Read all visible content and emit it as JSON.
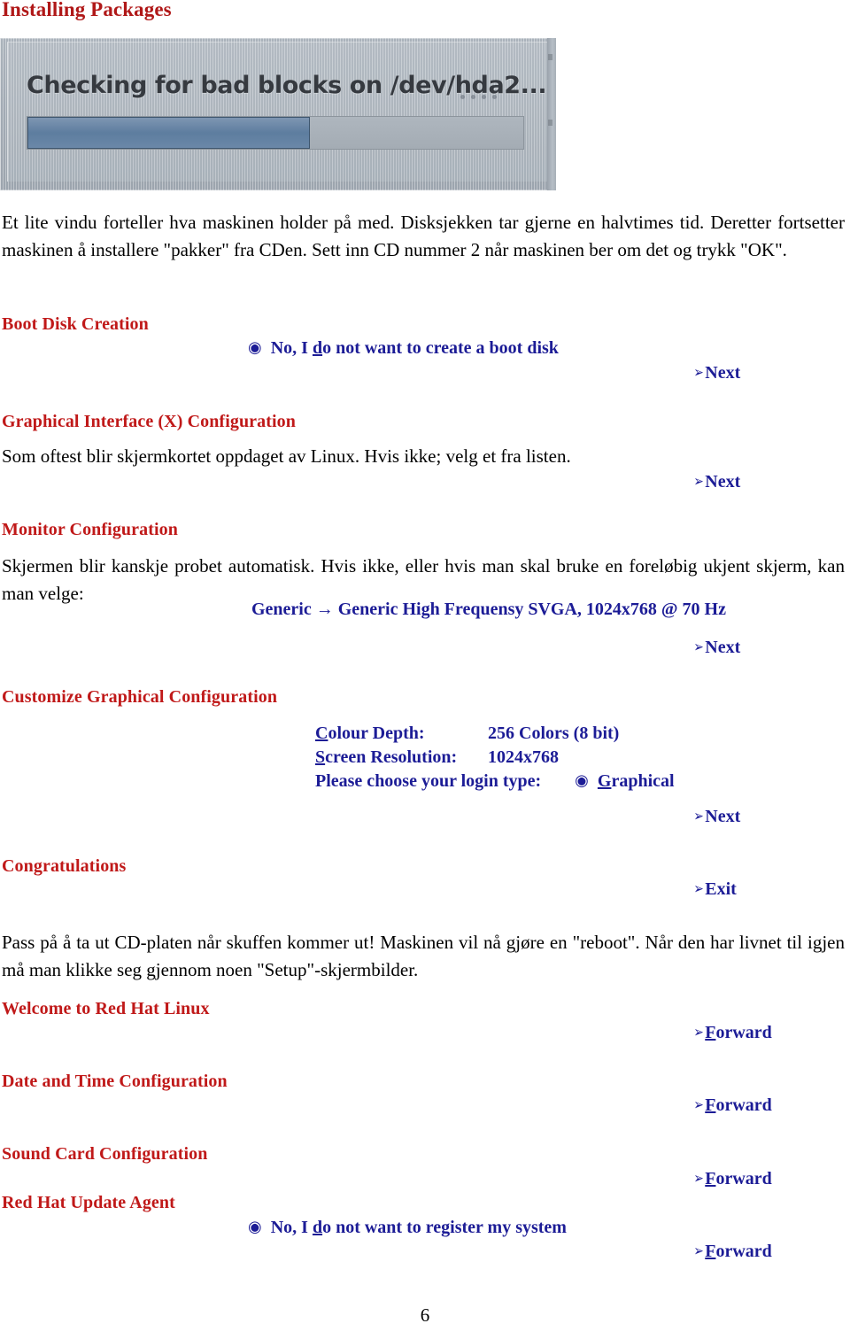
{
  "document": {
    "title": "Installing Packages",
    "page_number": "6",
    "heading_color": "#C01919",
    "accent_color": "#1C1C96"
  },
  "screenshot": {
    "name": "disk-check-dialog",
    "caption": "Checking for bad blocks on /dev/hda2...",
    "progress_percent": 57
  },
  "paragraphs": {
    "intro": "Et lite vindu forteller hva maskinen holder på med. Disksjekken tar gjerne en halvtimes tid. Deretter fortsetter maskinen å installere \"pakker\" fra CDen. Sett inn CD nummer 2 når maskinen ber om det og trykk \"OK\".",
    "graphical_interface": "Som oftest blir skjermkortet oppdaget av Linux. Hvis ikke; velg et fra listen.",
    "monitor": "Skjermen blir kanskje probet automatisk. Hvis ikke, eller hvis man skal bruke en foreløbig ukjent skjerm, kan man velge:",
    "congrats": "Pass på å ta ut CD-platen når skuffen kommer ut! Maskinen vil nå gjøre en \"reboot\". Når den har livnet til igjen må man klikke seg gjennom noen \"Setup\"-skjermbilder."
  },
  "sections": {
    "boot_disk": {
      "heading": "Boot Disk Creation",
      "option": "No, I do not want to create a boot disk",
      "nav": "Next"
    },
    "graphical_interface": {
      "heading": "Graphical Interface (X) Configuration",
      "nav": "Next"
    },
    "monitor": {
      "heading": "Monitor Configuration",
      "choice": "Generic → Generic High Frequensy SVGA, 1024x768 @ 70 Hz",
      "nav": "Next"
    },
    "customize": {
      "heading": "Customize Graphical Configuration",
      "colour_depth_label": "Colour Depth:",
      "colour_depth_value": "256 Colors (8 bit)",
      "screen_resolution_label": "Screen Resolution:",
      "screen_resolution_value": "1024x768",
      "login_type_label": "Please choose your login type:",
      "login_type_value": "Graphical",
      "nav": "Next"
    },
    "congratulations": {
      "heading": "Congratulations",
      "nav": "Exit"
    },
    "welcome": {
      "heading": "Welcome to Red Hat Linux",
      "nav": "Forward"
    },
    "datetime": {
      "heading": "Date and Time Configuration",
      "nav": "Forward"
    },
    "sound_card": {
      "heading": "Sound Card Configuration",
      "nav": "Forward"
    },
    "update_agent": {
      "heading": "Red Hat Update Agent",
      "option": "No, I do not want to register my system",
      "nav": "Forward"
    }
  },
  "icons": {
    "radio_selected": "⊙",
    "arrow_bullet": "➢",
    "right_arrow": "→"
  }
}
